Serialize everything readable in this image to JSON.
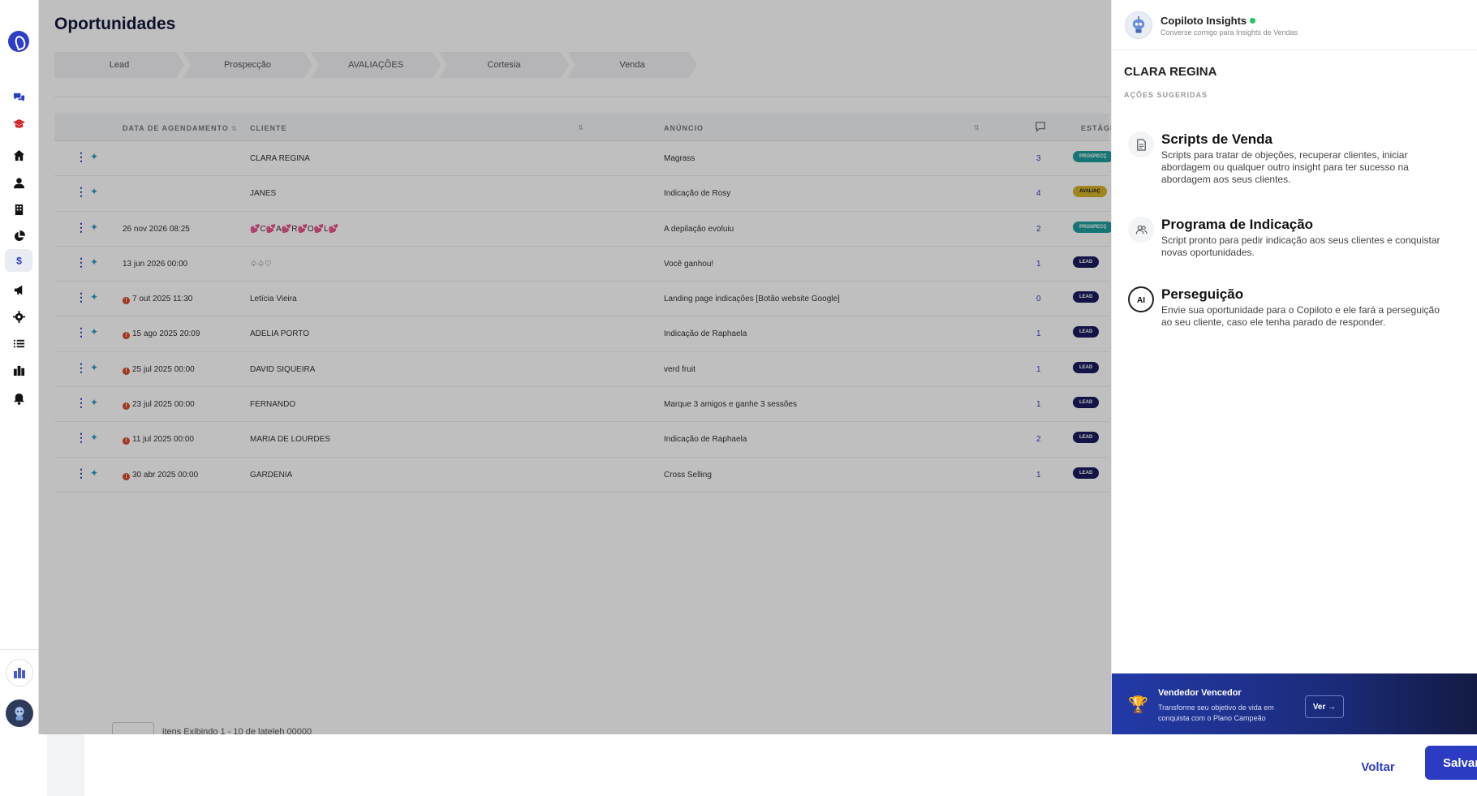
{
  "main": {
    "title": "Oportunidades",
    "stages": [
      "Lead",
      "Prospecção",
      "AVALIAÇÕES",
      "Cortesia",
      "Venda"
    ],
    "columns": {
      "date": "DATA DE AGENDAMENTO",
      "client": "CLIENTE",
      "ad": "ANÚNCIO",
      "stage": "ESTÁGI"
    },
    "rows": [
      {
        "date": "",
        "alert": false,
        "client": "CLARA REGINA",
        "ad": "Magrass",
        "count": "3",
        "stage": "PROSPECÇ",
        "stage_color": "#1f9e9b"
      },
      {
        "date": "",
        "alert": false,
        "client": "JANES",
        "ad": "Indicação de Rosy",
        "count": "4",
        "stage": "AVALIAÇ",
        "stage_color": "#d6b328"
      },
      {
        "date": "26 nov 2026 08:25",
        "alert": false,
        "client": "💕C💕A💕R💕O💕L💕",
        "ad": "A depilação evoluiu",
        "count": "2",
        "stage": "PROSPECÇ",
        "stage_color": "#1f9e9b"
      },
      {
        "date": "13 jun 2026 00:00",
        "alert": false,
        "client": "♤♤♡",
        "ad": "Você ganhou!",
        "count": "1",
        "stage": "LEAD",
        "stage_color": "#1b1a5e"
      },
      {
        "date": "7 out 2025 11:30",
        "alert": true,
        "client": "Letícia Vieira",
        "ad": "Landing page indicações [Botão website Google]",
        "count": "0",
        "stage": "LEAD",
        "stage_color": "#1b1a5e"
      },
      {
        "date": "15 ago 2025 20:09",
        "alert": true,
        "client": "ADELIA PORTO",
        "ad": "Indicação de Raphaela",
        "count": "1",
        "stage": "LEAD",
        "stage_color": "#1b1a5e"
      },
      {
        "date": "25 jul 2025 00:00",
        "alert": true,
        "client": "DAVID SIQUEIRA",
        "ad": "verd fruit",
        "count": "1",
        "stage": "LEAD",
        "stage_color": "#1b1a5e"
      },
      {
        "date": "23 jul 2025 00:00",
        "alert": true,
        "client": "FERNANDO",
        "ad": "Marque 3 amigos e ganhe 3 sessões",
        "count": "1",
        "stage": "LEAD",
        "stage_color": "#1b1a5e"
      },
      {
        "date": "11 jul 2025 00:00",
        "alert": true,
        "client": "MARIA DE LOURDES",
        "ad": "Indicação de Raphaela",
        "count": "2",
        "stage": "LEAD",
        "stage_color": "#1b1a5e"
      },
      {
        "date": "30 abr 2025 00:00",
        "alert": true,
        "client": "GARDENIA",
        "ad": "Cross Selling",
        "count": "1",
        "stage": "LEAD",
        "stage_color": "#1b1a5e"
      }
    ],
    "pager_text": "itens  Exibindo 1 - 10 de lateleh 00000"
  },
  "panel": {
    "title": "Copiloto Insights",
    "subtitle": "Converse comigo para Insights de Vendas",
    "client_name": "CLARA REGINA",
    "actions_label": "AÇÕES SUGERIDAS",
    "actions": [
      {
        "title": "Scripts de Venda",
        "icon": "document-icon",
        "desc": "Scripts para tratar de objeções, recuperar clientes, iniciar abordagem ou qualquer outro insight para ter sucesso na abordagem aos seus clientes."
      },
      {
        "title": "Programa de Indicação",
        "icon": "users-icon",
        "desc": "Script pronto para pedir indicação aos seus clientes e conquistar novas oportunidades."
      },
      {
        "title": "Perseguição",
        "icon": "ai-chat-icon",
        "desc": "Envie sua oportunidade para o Copiloto e ele fará a perseguição ao seu cliente, caso ele tenha parado de responder."
      }
    ],
    "promo": {
      "title": "Vendedor Vencedor",
      "desc": "Transforme seu objetivo de vida em conquista com o Plano Campeão",
      "button": "Ver →"
    }
  },
  "footer": {
    "back": "Voltar",
    "save": "Salvar"
  },
  "colors": {
    "brand": "#2b3cc2",
    "online": "#22c55e",
    "alert": "#d8482c"
  }
}
